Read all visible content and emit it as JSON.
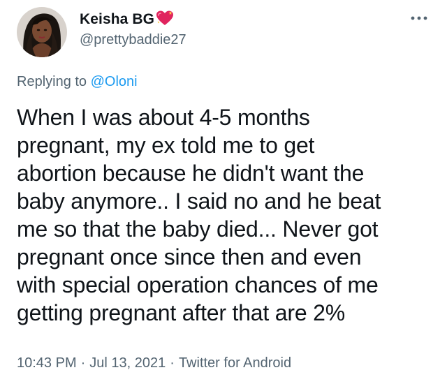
{
  "tweet": {
    "display_name": "Keisha BG",
    "handle": "@prettybaddie27",
    "reply_prefix": "Replying to ",
    "reply_to": "@Oloni",
    "text": "When I was about 4-5 months\npregnant, my ex told me to get\nabortion because he didn't want the\nbaby anymore.. I said no and he beat\nme so that the baby died... Never got\npregnant once since then and even\nwith  special operation chances of me\ngetting pregnant after that are 2%",
    "time": "10:43 PM",
    "separator": "·",
    "date": "Jul 13, 2021",
    "source": "Twitter for Android"
  },
  "icons": {
    "name_emoji": "sparkling-heart-icon",
    "more": "more-horizontal-icon"
  },
  "colors": {
    "text_primary": "#0f1419",
    "text_secondary": "#536471",
    "mention": "#1d9bf0",
    "heart": "#e0245e"
  }
}
